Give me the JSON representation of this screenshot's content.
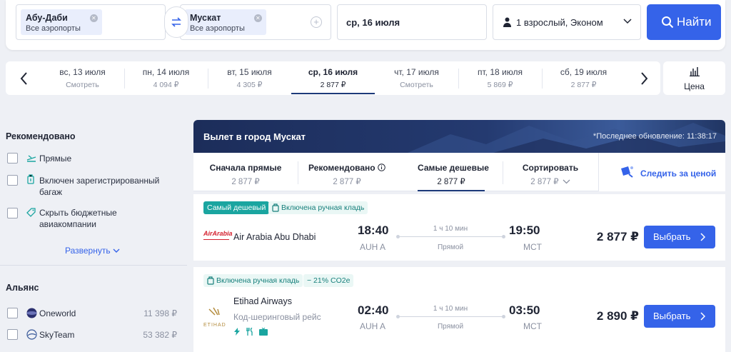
{
  "search": {
    "from": {
      "city": "Абу-Даби",
      "sub": "Все аэропорты"
    },
    "to": {
      "city": "Мускат",
      "sub": "Все аэропорты"
    },
    "date": "ср, 16 июля",
    "passengers": "1 взрослый, Эконом",
    "find_label": "Найти"
  },
  "date_strip": [
    {
      "day": "вс, 13 июля",
      "price": "Смотреть"
    },
    {
      "day": "пн, 14 июля",
      "price": "4 094 ₽"
    },
    {
      "day": "вт, 15 июля",
      "price": "4 305 ₽"
    },
    {
      "day": "ср, 16 июля",
      "price": "2 877 ₽",
      "active": true
    },
    {
      "day": "чт, 17 июля",
      "price": "Смотреть"
    },
    {
      "day": "пт, 18 июля",
      "price": "5 869 ₽"
    },
    {
      "day": "сб, 19 июля",
      "price": "2 877 ₽"
    }
  ],
  "price_view_label": "Цена",
  "sidebar": {
    "recommended_title": "Рекомендовано",
    "filters": [
      {
        "label": "Прямые"
      },
      {
        "label": "Включен зарегистрированный багаж"
      },
      {
        "label": "Скрыть бюджетные авиакомпании"
      }
    ],
    "expand_label": "Развернуть",
    "alliance_title": "Альянс",
    "alliances": [
      {
        "name": "Oneworld",
        "price": "11 398 ₽"
      },
      {
        "name": "SkyTeam",
        "price": "53 382 ₽"
      }
    ]
  },
  "results": {
    "title": "Вылет в город Мускат",
    "updated": "*Последнее обновление: 11:38:17",
    "sorts": [
      {
        "name": "Сначала прямые",
        "value": "2 877 ₽"
      },
      {
        "name": "Рекомендовано",
        "value": "2 877 ₽"
      },
      {
        "name": "Самые дешевые",
        "value": "2 877 ₽",
        "active": true
      },
      {
        "name": "Сортировать",
        "value": "2 877 ₽"
      }
    ],
    "track_label": "Следить за ценой",
    "flights": [
      {
        "badges": [
          "Самый дешевый",
          "Включена ручная кладь"
        ],
        "airline": "Air Arabia Abu Dhabi",
        "logo_text": "AirArabia",
        "dep": "18:40",
        "dep_ap": "AUH A",
        "arr": "19:50",
        "arr_ap": "MCT",
        "duration": "1 ч 10 мин",
        "stops": "Прямой",
        "price": "2 877 ₽",
        "select_label": "Выбрать"
      },
      {
        "badges": [
          "Включена ручная кладь",
          "− 21% CO2e"
        ],
        "airline": "Etihad Airways",
        "codeshare": "Код-шеринговый рейс",
        "logo_text": "ETIHAD",
        "dep": "02:40",
        "dep_ap": "AUH A",
        "arr": "03:50",
        "arr_ap": "MCT",
        "duration": "1 ч 10 мин",
        "stops": "Прямой",
        "price": "2 890 ₽",
        "select_label": "Выбрать"
      }
    ]
  },
  "colors": {
    "accent": "#3563e9",
    "dark": "#1d3a7a",
    "green": "#1aa5a0"
  }
}
